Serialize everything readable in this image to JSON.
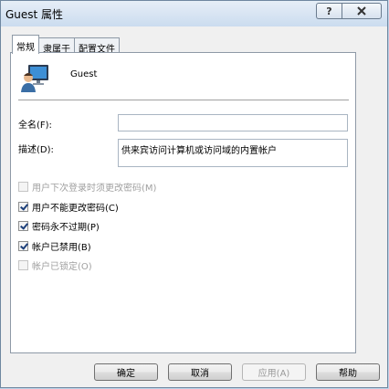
{
  "window": {
    "title": "Guest 属性",
    "help_button": "?",
    "close_icon": "close-icon"
  },
  "tabs": [
    {
      "label": "常规",
      "active": true
    },
    {
      "label": "隶属于",
      "active": false
    },
    {
      "label": "配置文件",
      "active": false
    }
  ],
  "general": {
    "username": "Guest",
    "avatar_icon": "user-avatar-icon",
    "fullname_label": "全名(F):",
    "fullname_value": "",
    "description_label": "描述(D):",
    "description_value": "供来宾访问计算机或访问域的内置帐户"
  },
  "options": [
    {
      "label": "用户下次登录时须更改密码(M)",
      "checked": false,
      "enabled": false
    },
    {
      "label": "用户不能更改密码(C)",
      "checked": true,
      "enabled": true
    },
    {
      "label": "密码永不过期(P)",
      "checked": true,
      "enabled": true
    },
    {
      "label": "帐户已禁用(B)",
      "checked": true,
      "enabled": true
    },
    {
      "label": "帐户已锁定(O)",
      "checked": false,
      "enabled": false
    }
  ],
  "buttons": {
    "ok": "确定",
    "cancel": "取消",
    "apply": "应用(A)",
    "help": "帮助"
  }
}
